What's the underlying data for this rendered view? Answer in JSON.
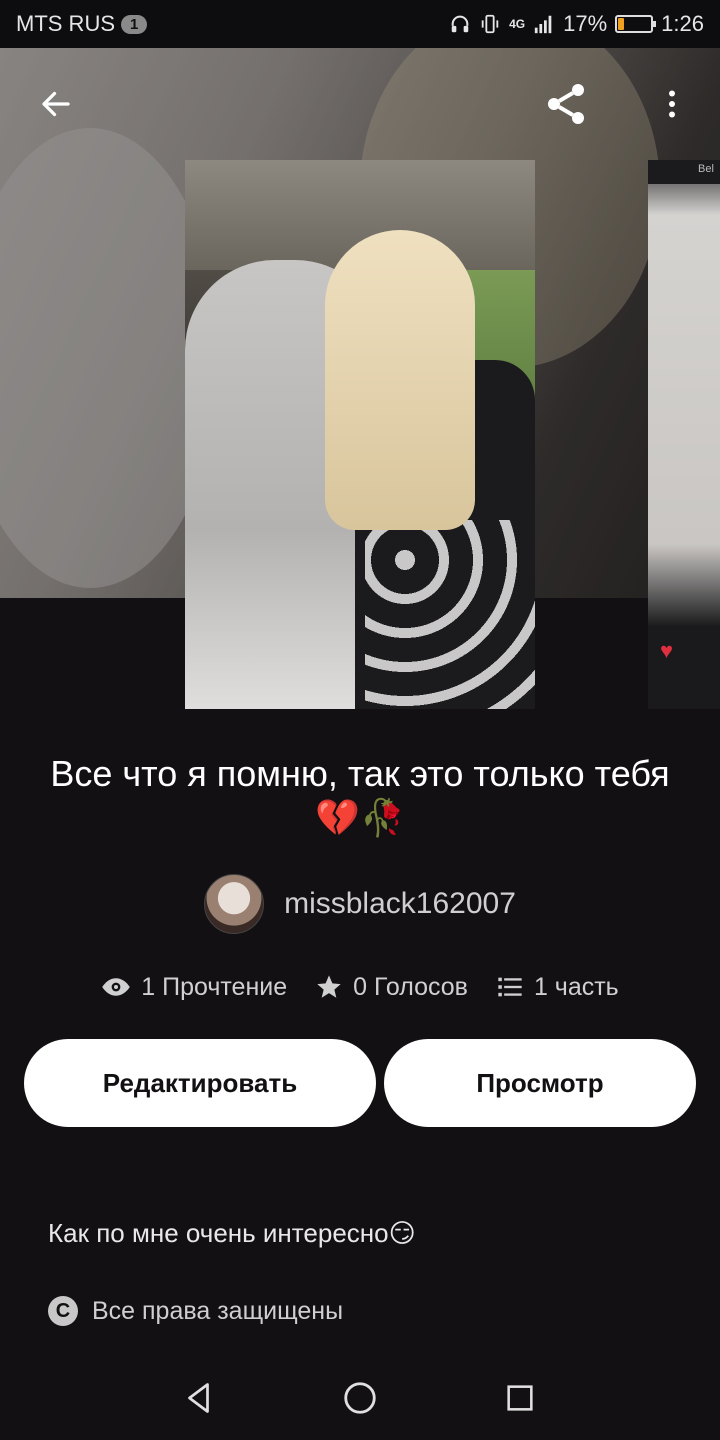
{
  "status_bar": {
    "carrier": "MTS RUS",
    "sim_badge": "1",
    "network": "4G",
    "battery_percent": "17%",
    "battery_level": 0.17,
    "time": "1:26",
    "icons": [
      "headphones-icon",
      "vibrate-icon",
      "signal-icon",
      "battery-icon"
    ]
  },
  "header": {
    "back_icon": "arrow-left-icon",
    "share_icon": "share-icon",
    "more_icon": "more-vertical-icon"
  },
  "carousel": {
    "side_cover_text": "Bel"
  },
  "story": {
    "title": "Все что я помню, так это только тебя💔🥀",
    "author": "missblack162007",
    "stats": {
      "reads": "1 Прочтение",
      "votes": "0 Голосов",
      "parts": "1 часть"
    },
    "description": "Как по мне очень интересно😏",
    "rights": "Все права защищены"
  },
  "buttons": {
    "edit": "Редактировать",
    "view": "Просмотр"
  },
  "nav": {
    "back": "triangle-back-icon",
    "home": "circle-home-icon",
    "recents": "square-recents-icon"
  },
  "colors": {
    "background": "#121013",
    "button_bg": "#ffffff",
    "text_primary": "#ffffff",
    "text_secondary": "#cfcfcf"
  }
}
